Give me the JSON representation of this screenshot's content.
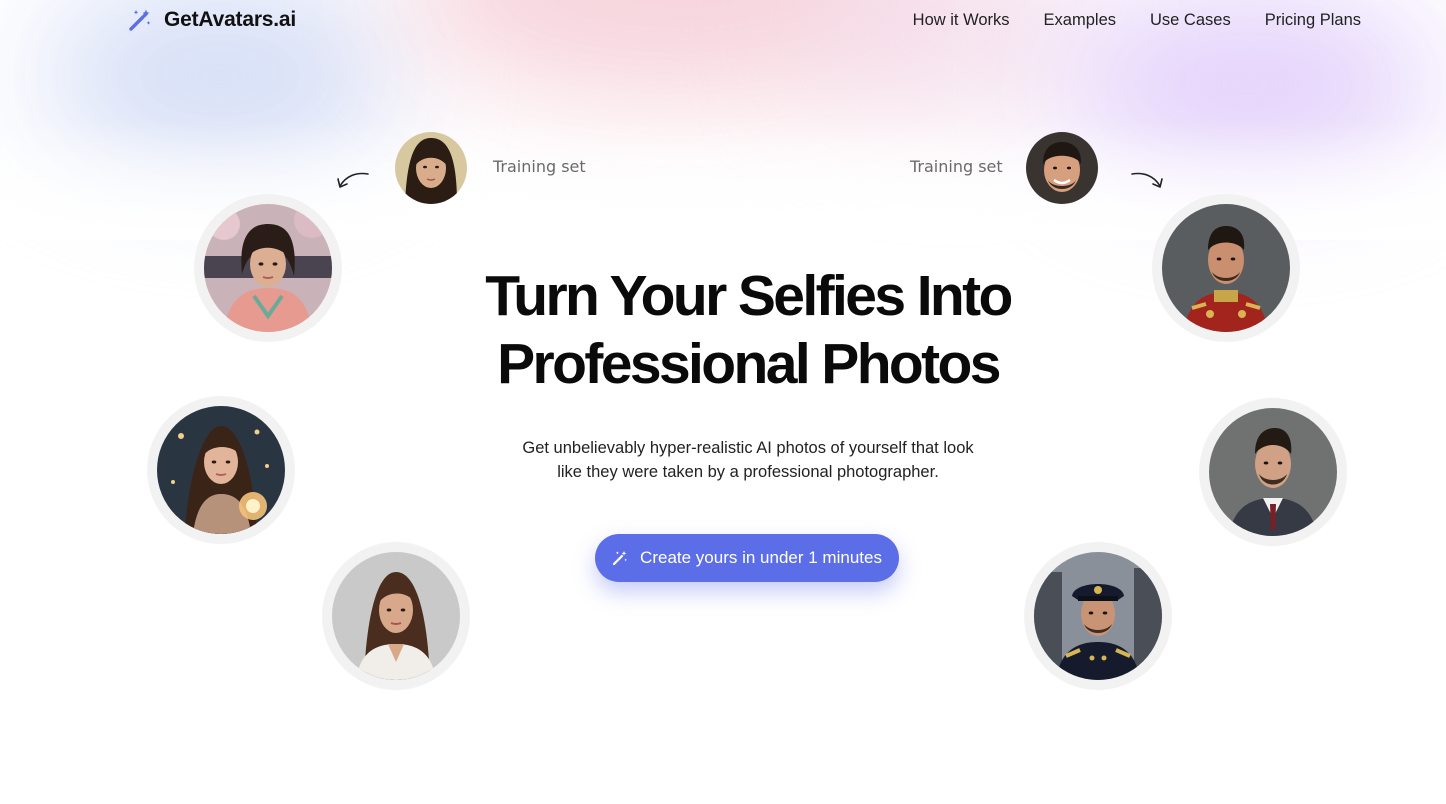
{
  "brand": {
    "name": "GetAvatars.ai",
    "icon": "magic-wand-icon",
    "accent": "#5b6ee7"
  },
  "nav": {
    "items": [
      {
        "label": "How it Works"
      },
      {
        "label": "Examples"
      },
      {
        "label": "Use Cases"
      },
      {
        "label": "Pricing Plans"
      }
    ]
  },
  "training": {
    "left_label": "Training set",
    "right_label": "Training set"
  },
  "hero": {
    "title_line1": "Turn Your Selfies Into",
    "title_line2": "Professional Photos",
    "subtitle_line1": "Get unbelievably hyper-realistic AI photos of yourself that look",
    "subtitle_line2": "like they were taken by a professional photographer."
  },
  "cta": {
    "label": "Create yours in under 1 minutes",
    "icon": "magic-wand-icon"
  },
  "avatars": {
    "training_woman": "woman-selfie-photo",
    "training_man": "man-selfie-photo",
    "left": [
      "woman-kimono-photo",
      "woman-fantasy-lantern-photo",
      "woman-business-photo"
    ],
    "right": [
      "man-military-uniform-photo",
      "man-suit-portrait-photo",
      "man-naval-officer-photo"
    ]
  }
}
